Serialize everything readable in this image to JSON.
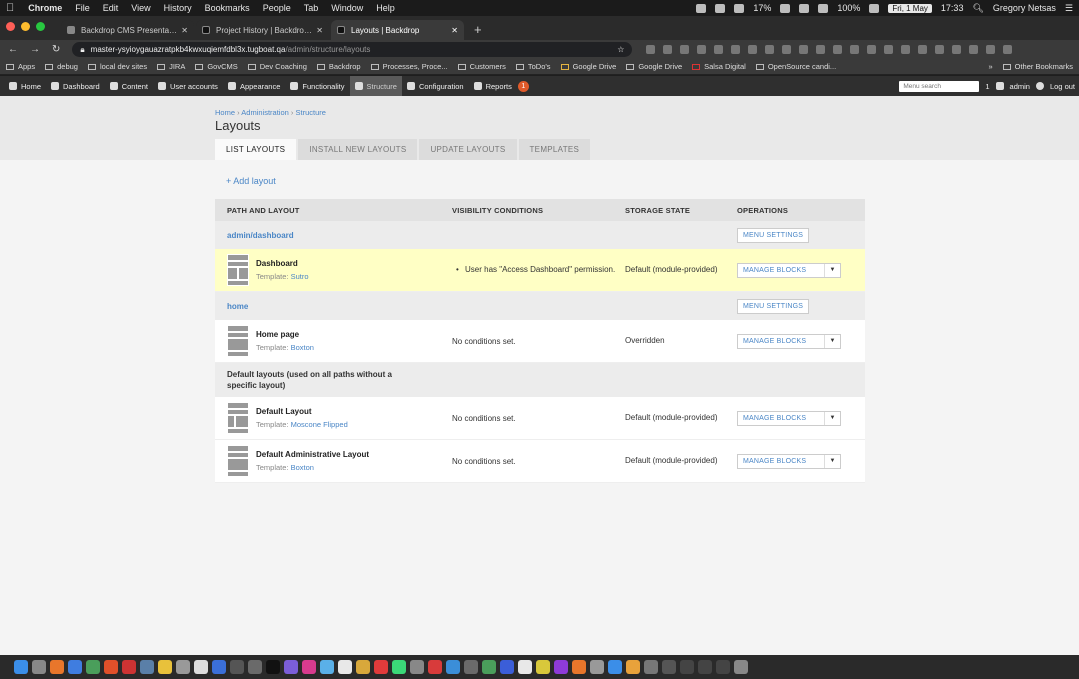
{
  "macos": {
    "apple": "",
    "menus": [
      "Chrome",
      "File",
      "Edit",
      "View",
      "History",
      "Bookmarks",
      "People",
      "Tab",
      "Window",
      "Help"
    ],
    "battery": "17%",
    "wifi_pct": "100%",
    "date": "Fri, 1 May",
    "time": "17:33",
    "user": "Gregory Netsas"
  },
  "browser": {
    "tabs": [
      {
        "title": "Backdrop CMS Presentations |"
      },
      {
        "title": "Project History | Backdrop CMS"
      },
      {
        "title": "Layouts | Backdrop"
      }
    ],
    "url_host": "master-ysyioygauazratpkb4kwxuqiemfdbl3x.tugboat.qa",
    "url_path": "/admin/structure/layouts",
    "bookmarks": [
      "Apps",
      "debug",
      "local dev sites",
      "JIRA",
      "GovCMS",
      "Dev Coaching",
      "Backdrop",
      "Processes, Proce...",
      "Customers",
      "ToDo's",
      "Google Drive",
      "Google Drive",
      "Salsa Digital",
      "OpenSource candi..."
    ],
    "other_bookmarks": "Other Bookmarks"
  },
  "adminbar": {
    "items": [
      "Home",
      "Dashboard",
      "Content",
      "User accounts",
      "Appearance",
      "Functionality",
      "Structure",
      "Configuration",
      "Reports"
    ],
    "notifications": "1",
    "search_placeholder": "Menu search",
    "user_count": "1",
    "username": "admin",
    "logout": "Log out"
  },
  "page": {
    "breadcrumb": [
      "Home",
      "Administration",
      "Structure"
    ],
    "title": "Layouts",
    "tabs": [
      "LIST LAYOUTS",
      "INSTALL NEW LAYOUTS",
      "UPDATE LAYOUTS",
      "TEMPLATES"
    ],
    "add_layout": "+ Add layout",
    "columns": [
      "PATH AND LAYOUT",
      "VISIBILITY CONDITIONS",
      "STORAGE STATE",
      "OPERATIONS"
    ],
    "groups": [
      {
        "path": "admin/dashboard",
        "action": "MENU SETTINGS",
        "layouts": [
          {
            "name": "Dashboard",
            "template_label": "Template:",
            "template": "Sutro",
            "conditions": "User has \"Access Dashboard\" permission.",
            "storage": "Default (module-provided)",
            "operation": "MANAGE BLOCKS"
          }
        ]
      },
      {
        "path": "home",
        "action": "MENU SETTINGS",
        "layouts": [
          {
            "name": "Home page",
            "template_label": "Template:",
            "template": "Boxton",
            "conditions": "No conditions set.",
            "storage": "Overridden",
            "operation": "MANAGE BLOCKS"
          }
        ]
      },
      {
        "path": "Default layouts (used on all paths without a specific layout)",
        "action": "",
        "layouts": [
          {
            "name": "Default Layout",
            "template_label": "Template:",
            "template": "Moscone Flipped",
            "conditions": "No conditions set.",
            "storage": "Default (module-provided)",
            "operation": "MANAGE BLOCKS"
          },
          {
            "name": "Default Administrative Layout",
            "template_label": "Template:",
            "template": "Boxton",
            "conditions": "No conditions set.",
            "storage": "Default (module-provided)",
            "operation": "MANAGE BLOCKS"
          }
        ]
      }
    ]
  },
  "colors": {
    "link": "#4a86c6",
    "highlight_row": "#ffffc5",
    "admin_bar": "#2f2f2f"
  }
}
